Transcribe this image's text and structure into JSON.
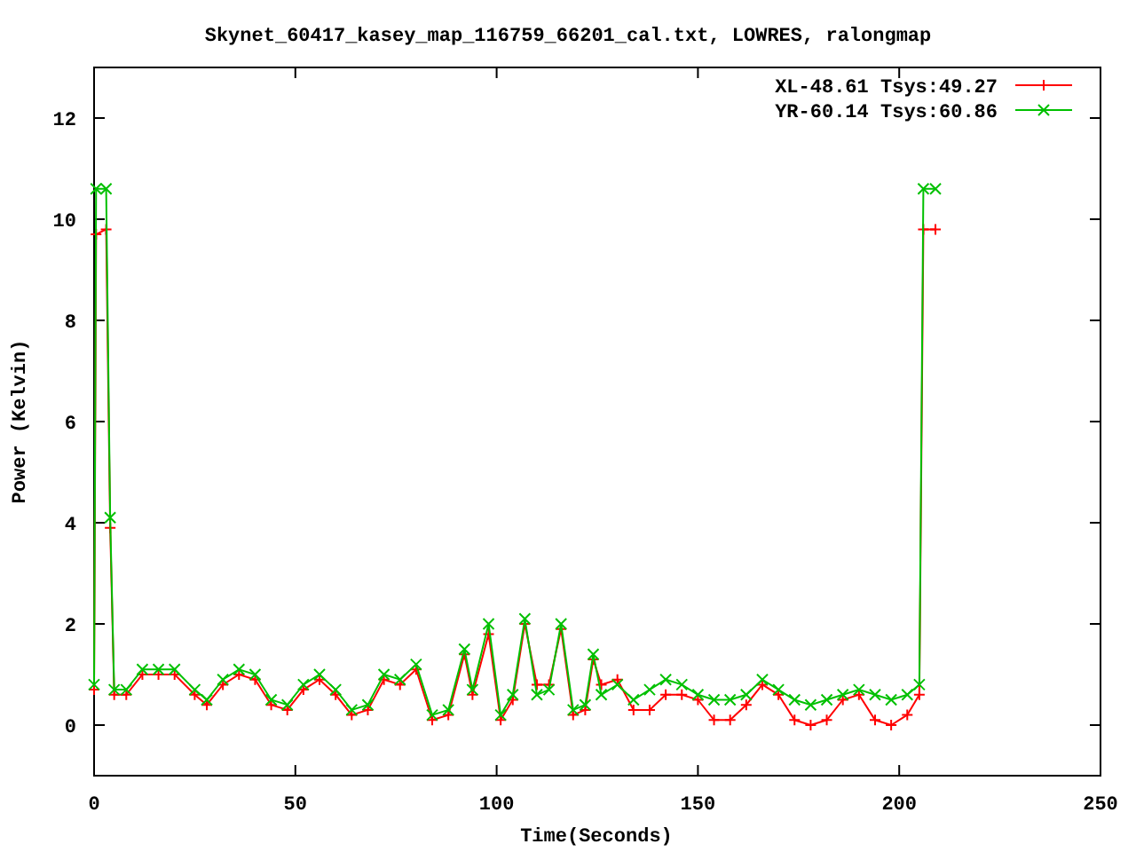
{
  "chart_data": {
    "type": "line",
    "title": "Skynet_60417_kasey_map_116759_66201_cal.txt, LOWRES, ralongmap",
    "xlabel": "Time(Seconds)",
    "ylabel": "Power (Kelvin)",
    "x": [
      0,
      0.5,
      3,
      4,
      5,
      8,
      12,
      16,
      20,
      25,
      28,
      32,
      36,
      40,
      44,
      48,
      52,
      56,
      60,
      64,
      68,
      72,
      76,
      80,
      84,
      88,
      92,
      94,
      98,
      101,
      104,
      107,
      110,
      113,
      116,
      119,
      122,
      124,
      126,
      130,
      134,
      138,
      142,
      146,
      150,
      154,
      158,
      162,
      166,
      170,
      174,
      178,
      182,
      186,
      190,
      194,
      198,
      202,
      205,
      206,
      209
    ],
    "series": [
      {
        "name": "XL-48.61 Tsys:49.27",
        "color": "#ff0000",
        "marker": "cross",
        "values": [
          0.7,
          9.7,
          9.8,
          3.9,
          0.6,
          0.6,
          1.0,
          1.0,
          1.0,
          0.6,
          0.4,
          0.8,
          1.0,
          0.9,
          0.4,
          0.3,
          0.7,
          0.9,
          0.6,
          0.2,
          0.3,
          0.9,
          0.8,
          1.1,
          0.1,
          0.2,
          1.4,
          0.6,
          1.8,
          0.1,
          0.5,
          2.0,
          0.8,
          0.8,
          1.9,
          0.2,
          0.3,
          1.3,
          0.8,
          0.9,
          0.3,
          0.3,
          0.6,
          0.6,
          0.5,
          0.1,
          0.1,
          0.4,
          0.8,
          0.6,
          0.1,
          0.0,
          0.1,
          0.5,
          0.6,
          0.1,
          0.0,
          0.2,
          0.6,
          9.8,
          9.8
        ]
      },
      {
        "name": "YR-60.14 Tsys:60.86",
        "color": "#00c000",
        "marker": "cross",
        "values": [
          0.8,
          10.6,
          10.6,
          4.1,
          0.7,
          0.7,
          1.1,
          1.1,
          1.1,
          0.7,
          0.5,
          0.9,
          1.1,
          1.0,
          0.5,
          0.4,
          0.8,
          1.0,
          0.7,
          0.3,
          0.4,
          1.0,
          0.9,
          1.2,
          0.2,
          0.3,
          1.5,
          0.7,
          2.0,
          0.2,
          0.6,
          2.1,
          0.6,
          0.7,
          2.0,
          0.3,
          0.4,
          1.4,
          0.6,
          0.8,
          0.5,
          0.7,
          0.9,
          0.8,
          0.6,
          0.5,
          0.5,
          0.6,
          0.9,
          0.7,
          0.5,
          0.4,
          0.5,
          0.6,
          0.7,
          0.6,
          0.5,
          0.6,
          0.8,
          10.6,
          10.6
        ]
      }
    ],
    "legend": true,
    "xlim": [
      0,
      250
    ],
    "ylim": [
      -1,
      13
    ],
    "xticks": [
      0,
      50,
      100,
      150,
      200,
      250
    ],
    "yticks": [
      0,
      2,
      4,
      6,
      8,
      10,
      12
    ]
  }
}
